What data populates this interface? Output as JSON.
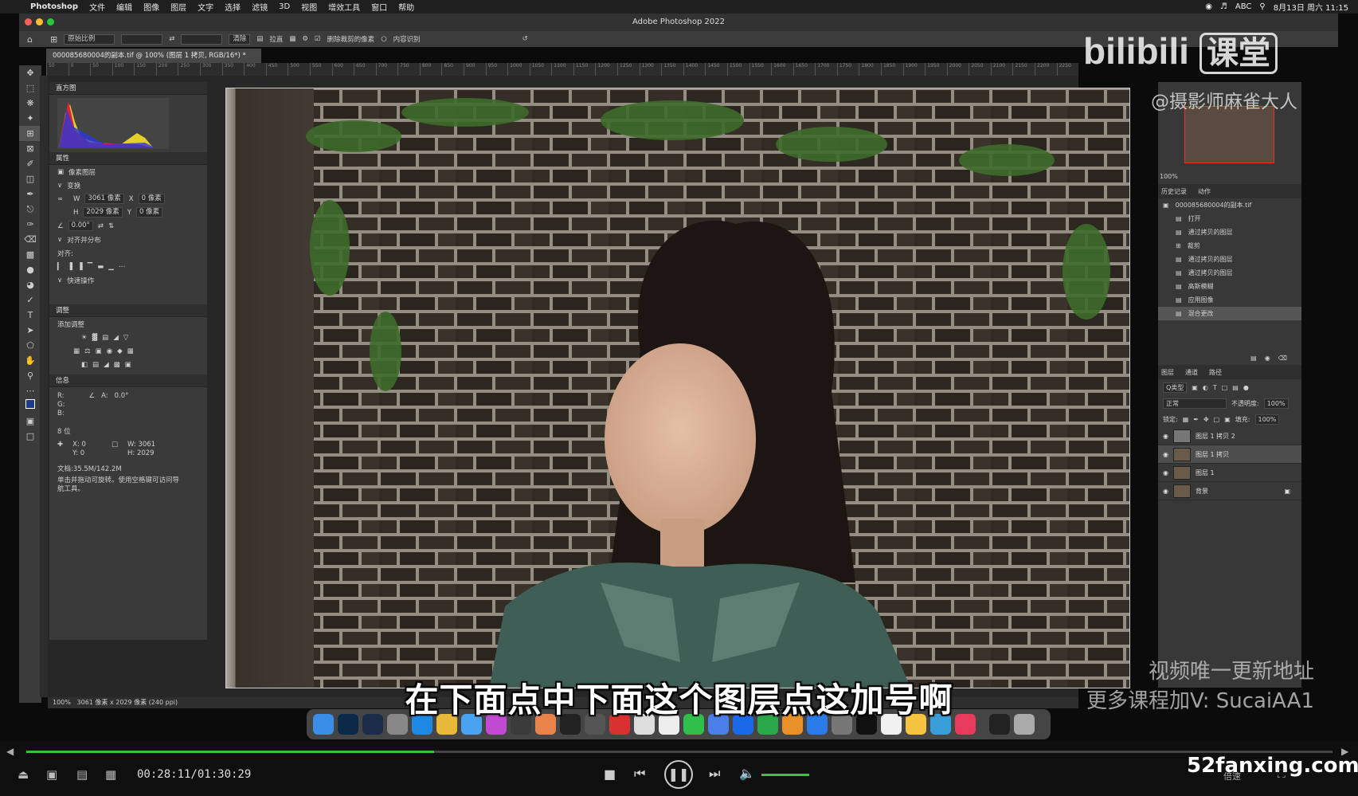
{
  "menubar": {
    "app": "Photoshop",
    "items": [
      "文件",
      "编辑",
      "图像",
      "图层",
      "文字",
      "选择",
      "滤镜",
      "3D",
      "视图",
      "增效工具",
      "窗口",
      "帮助"
    ],
    "status_date": "8月13日 周六 11:15",
    "input": "ABC"
  },
  "window": {
    "title": "Adobe Photoshop 2022"
  },
  "options": {
    "ratio": "原始比例",
    "clear": "清除",
    "straighten": "拉直",
    "delete_cropped": "删除裁剪的像素",
    "content_aware": "内容识别"
  },
  "doc": {
    "tab": "000085680004的副本.tif @ 100% (图层 1 拷贝, RGB/16*) *"
  },
  "ruler": [
    "50",
    "0",
    "50",
    "100",
    "150",
    "200",
    "250",
    "300",
    "350",
    "400",
    "450",
    "500",
    "550",
    "600",
    "650",
    "700",
    "750",
    "800",
    "850",
    "900",
    "950",
    "1000",
    "1050",
    "1100",
    "1150",
    "1200",
    "1250",
    "1300",
    "1350",
    "1400",
    "1450",
    "1500",
    "1550",
    "1600",
    "1650",
    "1700",
    "1750",
    "1800",
    "1850",
    "1900",
    "1950",
    "2000",
    "2050",
    "2100",
    "2150",
    "2200",
    "2250"
  ],
  "left": {
    "histogram": "直方图",
    "properties": "属性",
    "pixel_layer": "像素图层",
    "transform": "变换",
    "w_label": "W",
    "w": "3061 像素",
    "x_label": "X",
    "x": "0 像素",
    "h_label": "H",
    "h": "2029 像素",
    "y_label": "Y",
    "y": "0 像素",
    "angle": "0.00°",
    "align": "对齐并分布",
    "align_to": "对齐:",
    "quick": "快速操作",
    "adjust": "调整",
    "add_adjust": "添加调整",
    "info": "信息",
    "r": "R:",
    "g": "G:",
    "b": "B:",
    "a_label": "A:",
    "a_val": "0.0°",
    "bit": "8 位",
    "ix": "X:",
    "iy": "Y:",
    "ix_val": "0",
    "iy_val": "0",
    "iw": "W:",
    "ih": "H:",
    "iw_val": "3061",
    "ih_val": "2029",
    "doc_size": "文档:35.5M/142.2M",
    "hint": "单击并拖动可旋转。使用空格键可访问导航工具。"
  },
  "right": {
    "zoom": "100%",
    "history_tab": "历史记录",
    "actions_tab": "动作",
    "history_file": "000085680004的副本.tif",
    "history": [
      "打开",
      "通过拷贝的图层",
      "裁剪",
      "通过拷贝的图层",
      "通过拷贝的图层",
      "高斯模糊",
      "应用图像",
      "混合更改"
    ],
    "layers_tab": "图层",
    "channels_tab": "通道",
    "paths_tab": "路径",
    "kind": "Q类型",
    "blend": "正常",
    "opacity_label": "不透明度:",
    "opacity": "100%",
    "lock_label": "锁定:",
    "fill_label": "填充:",
    "fill": "100%",
    "layers": [
      "图层 1 拷贝 2",
      "图层 1 拷贝",
      "图层 1",
      "背景"
    ]
  },
  "statusbar": {
    "zoom": "100%",
    "dims": "3061 像素 x 2029 像素 (240 ppi)"
  },
  "overlay": {
    "subtitle": "在下面点中下面这个图层点这加号啊",
    "wm1": "视频唯一更新地址",
    "wm2": "更多课程加V: SucaiAA1",
    "bili": "bilibili",
    "bili2": "课堂",
    "handle": "@摄影师麻雀大人",
    "site": "52fanxing.com"
  },
  "player": {
    "time": "00:28:11/01:30:29",
    "progress": 0.312,
    "speed": "倍速"
  },
  "colors": {
    "progress": "#3fbf3f",
    "panel": "#3a3a3a",
    "photo_wall": "#3a3631"
  }
}
